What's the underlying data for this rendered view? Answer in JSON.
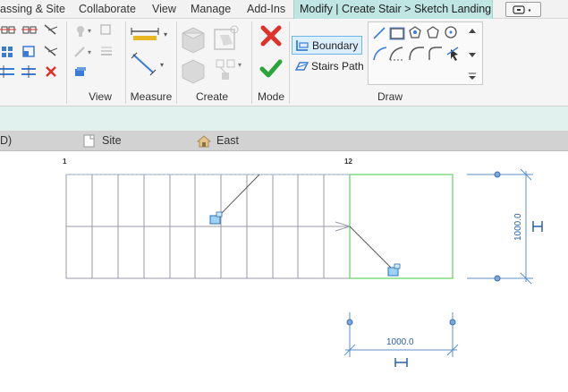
{
  "tabs": [
    {
      "label": "assing & Site",
      "active": false
    },
    {
      "label": "Collaborate",
      "active": false
    },
    {
      "label": "View",
      "active": false
    },
    {
      "label": "Manage",
      "active": false
    },
    {
      "label": "Add-Ins",
      "active": false
    },
    {
      "label": "Modify | Create Stair > Sketch Landing",
      "active": true
    }
  ],
  "ribbon": {
    "panels": {
      "view": "View",
      "measure": "Measure",
      "create": "Create",
      "mode": "Mode",
      "draw": "Draw"
    },
    "draw": {
      "boundary_label": "Boundary",
      "stairs_path_label": "Stairs Path"
    }
  },
  "view_tabs": {
    "left_partial": "D)",
    "site": "Site",
    "east": "East"
  },
  "drawing": {
    "label_left": "1",
    "label_right": "12",
    "dim_horizontal": "1000.0",
    "dim_vertical": "1000.0"
  },
  "colors": {
    "accent_tab": "#bfe6e2",
    "infobar": "#e0f1ee",
    "sketch_green": "#5fd35f",
    "dimension_blue": "#5b8fc9",
    "cancel_red": "#e0302a",
    "finish_green": "#2aa53a"
  }
}
